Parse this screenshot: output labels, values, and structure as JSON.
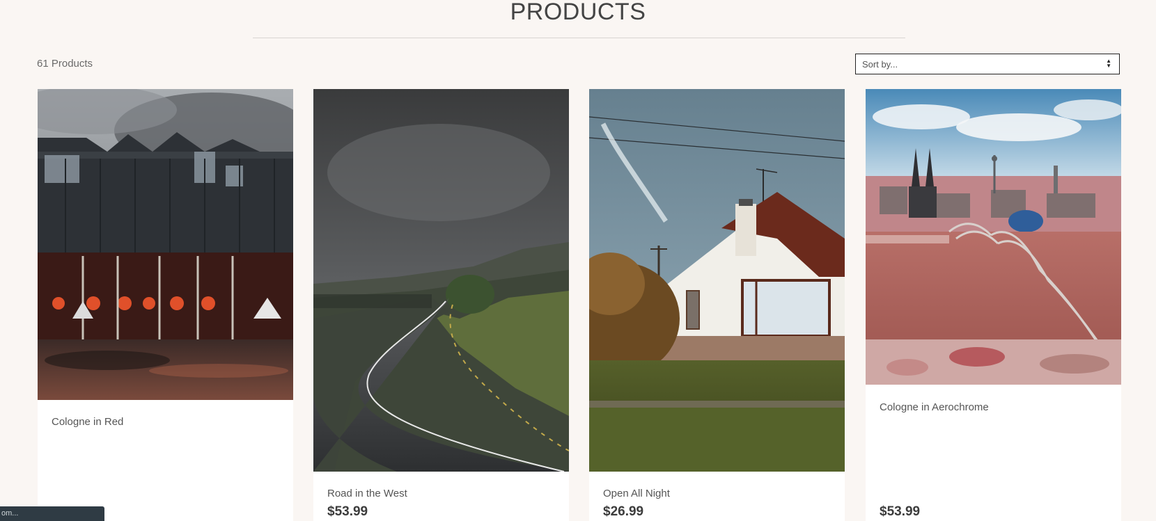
{
  "header": {
    "title": "PRODUCTS"
  },
  "toolbar": {
    "product_count": "61 Products",
    "sort_label": "Sort by..."
  },
  "products": [
    {
      "name": "Cologne in Red",
      "price": ""
    },
    {
      "name": "Road in the West",
      "price": "$53.99"
    },
    {
      "name": "Open All Night",
      "price": "$26.99"
    },
    {
      "name": "Cologne in Aerochrome",
      "price": "$53.99"
    }
  ],
  "status_bar": {
    "text": "om..."
  }
}
